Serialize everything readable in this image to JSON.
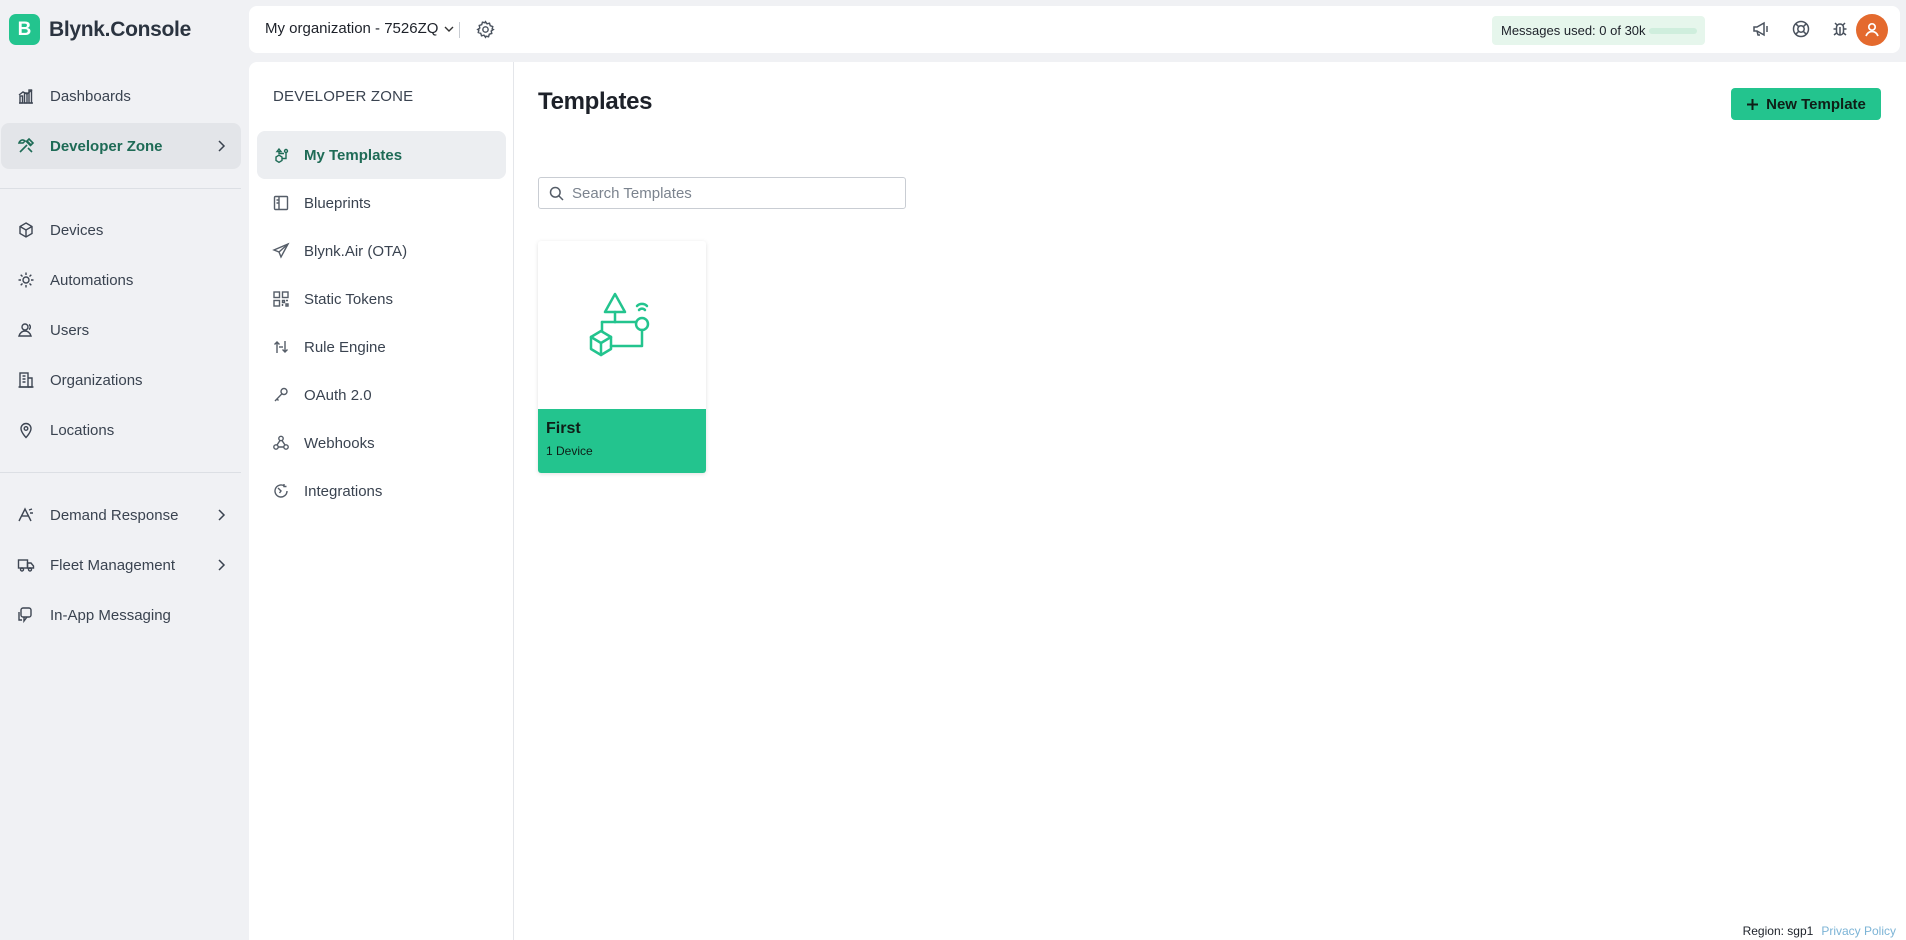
{
  "brand": {
    "logo_letter": "B",
    "name": "Blynk.Console",
    "accent": "#23c48e"
  },
  "sidebar": {
    "items": [
      {
        "label": "Dashboards",
        "icon": "bar-chart-icon"
      },
      {
        "label": "Developer Zone",
        "icon": "tools-icon",
        "active": true,
        "has_submenu": true
      },
      {
        "label": "Devices",
        "icon": "cube-icon"
      },
      {
        "label": "Automations",
        "icon": "sun-icon"
      },
      {
        "label": "Users",
        "icon": "users-icon"
      },
      {
        "label": "Organizations",
        "icon": "building-icon"
      },
      {
        "label": "Locations",
        "icon": "pin-icon"
      },
      {
        "label": "Demand Response",
        "icon": "signal-icon",
        "has_submenu": true
      },
      {
        "label": "Fleet Management",
        "icon": "truck-icon",
        "has_submenu": true
      },
      {
        "label": "In-App Messaging",
        "icon": "message-icon"
      }
    ]
  },
  "topbar": {
    "org_name": "My organization - 7526ZQ",
    "messages_used": "Messages used: 0 of 30k",
    "messages_used_fraction": 0,
    "icons": [
      "megaphone-icon",
      "help-icon",
      "bug-icon",
      "user-avatar-icon"
    ],
    "avatar_color": "#e46a2e"
  },
  "subnav": {
    "title": "DEVELOPER ZONE",
    "items": [
      {
        "label": "My Templates",
        "icon": "templates-icon",
        "active": true
      },
      {
        "label": "Blueprints",
        "icon": "blueprint-icon"
      },
      {
        "label": "Blynk.Air (OTA)",
        "icon": "paper-plane-icon"
      },
      {
        "label": "Static Tokens",
        "icon": "qr-code-icon"
      },
      {
        "label": "Rule Engine",
        "icon": "rule-engine-icon"
      },
      {
        "label": "OAuth 2.0",
        "icon": "key-icon"
      },
      {
        "label": "Webhooks",
        "icon": "webhook-icon"
      },
      {
        "label": "Integrations",
        "icon": "integrations-icon"
      }
    ]
  },
  "main": {
    "title": "Templates",
    "new_button_label": "New Template",
    "search_placeholder": "Search Templates",
    "search_value": "",
    "templates": [
      {
        "name": "First",
        "device_count": "1 Device"
      }
    ]
  },
  "footer": {
    "region": "Region: sgp1",
    "privacy_link": "Privacy Policy"
  }
}
